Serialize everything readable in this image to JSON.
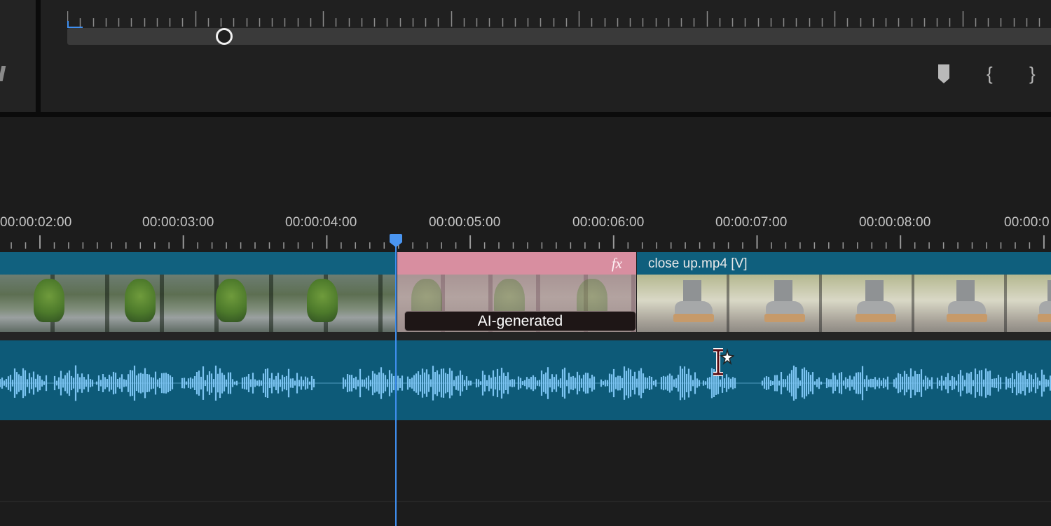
{
  "monitor": {
    "scrubber_value_fraction": 0.16,
    "controls": {
      "add_marker": "marker-icon",
      "mark_in": "{",
      "mark_out": "}"
    }
  },
  "timeline": {
    "timecodes": [
      "00:00:02:00",
      "00:00:03:00",
      "00:00:04:00",
      "00:00:05:00",
      "00:00:06:00",
      "00:00:07:00",
      "00:00:08:00",
      "00:00:0"
    ],
    "playhead_timecode_approx": "00:00:04:12",
    "video_track": {
      "clips": [
        {
          "name": "",
          "color": "#11617f",
          "thumbnail": "forest-scene"
        },
        {
          "name": "",
          "color": "#d88ea0",
          "effect_icon": "fx",
          "badge": "AI-generated",
          "thumbnail": "forest-scene-ai"
        },
        {
          "name": "close up.mp4 [V]",
          "color": "#0f5f7d",
          "thumbnail": "boots-close-up"
        }
      ]
    },
    "audio_track": {
      "color": "#0d5a78",
      "waveform_color": "#7cc4f2"
    },
    "playhead_color": "#3f8ff0"
  }
}
